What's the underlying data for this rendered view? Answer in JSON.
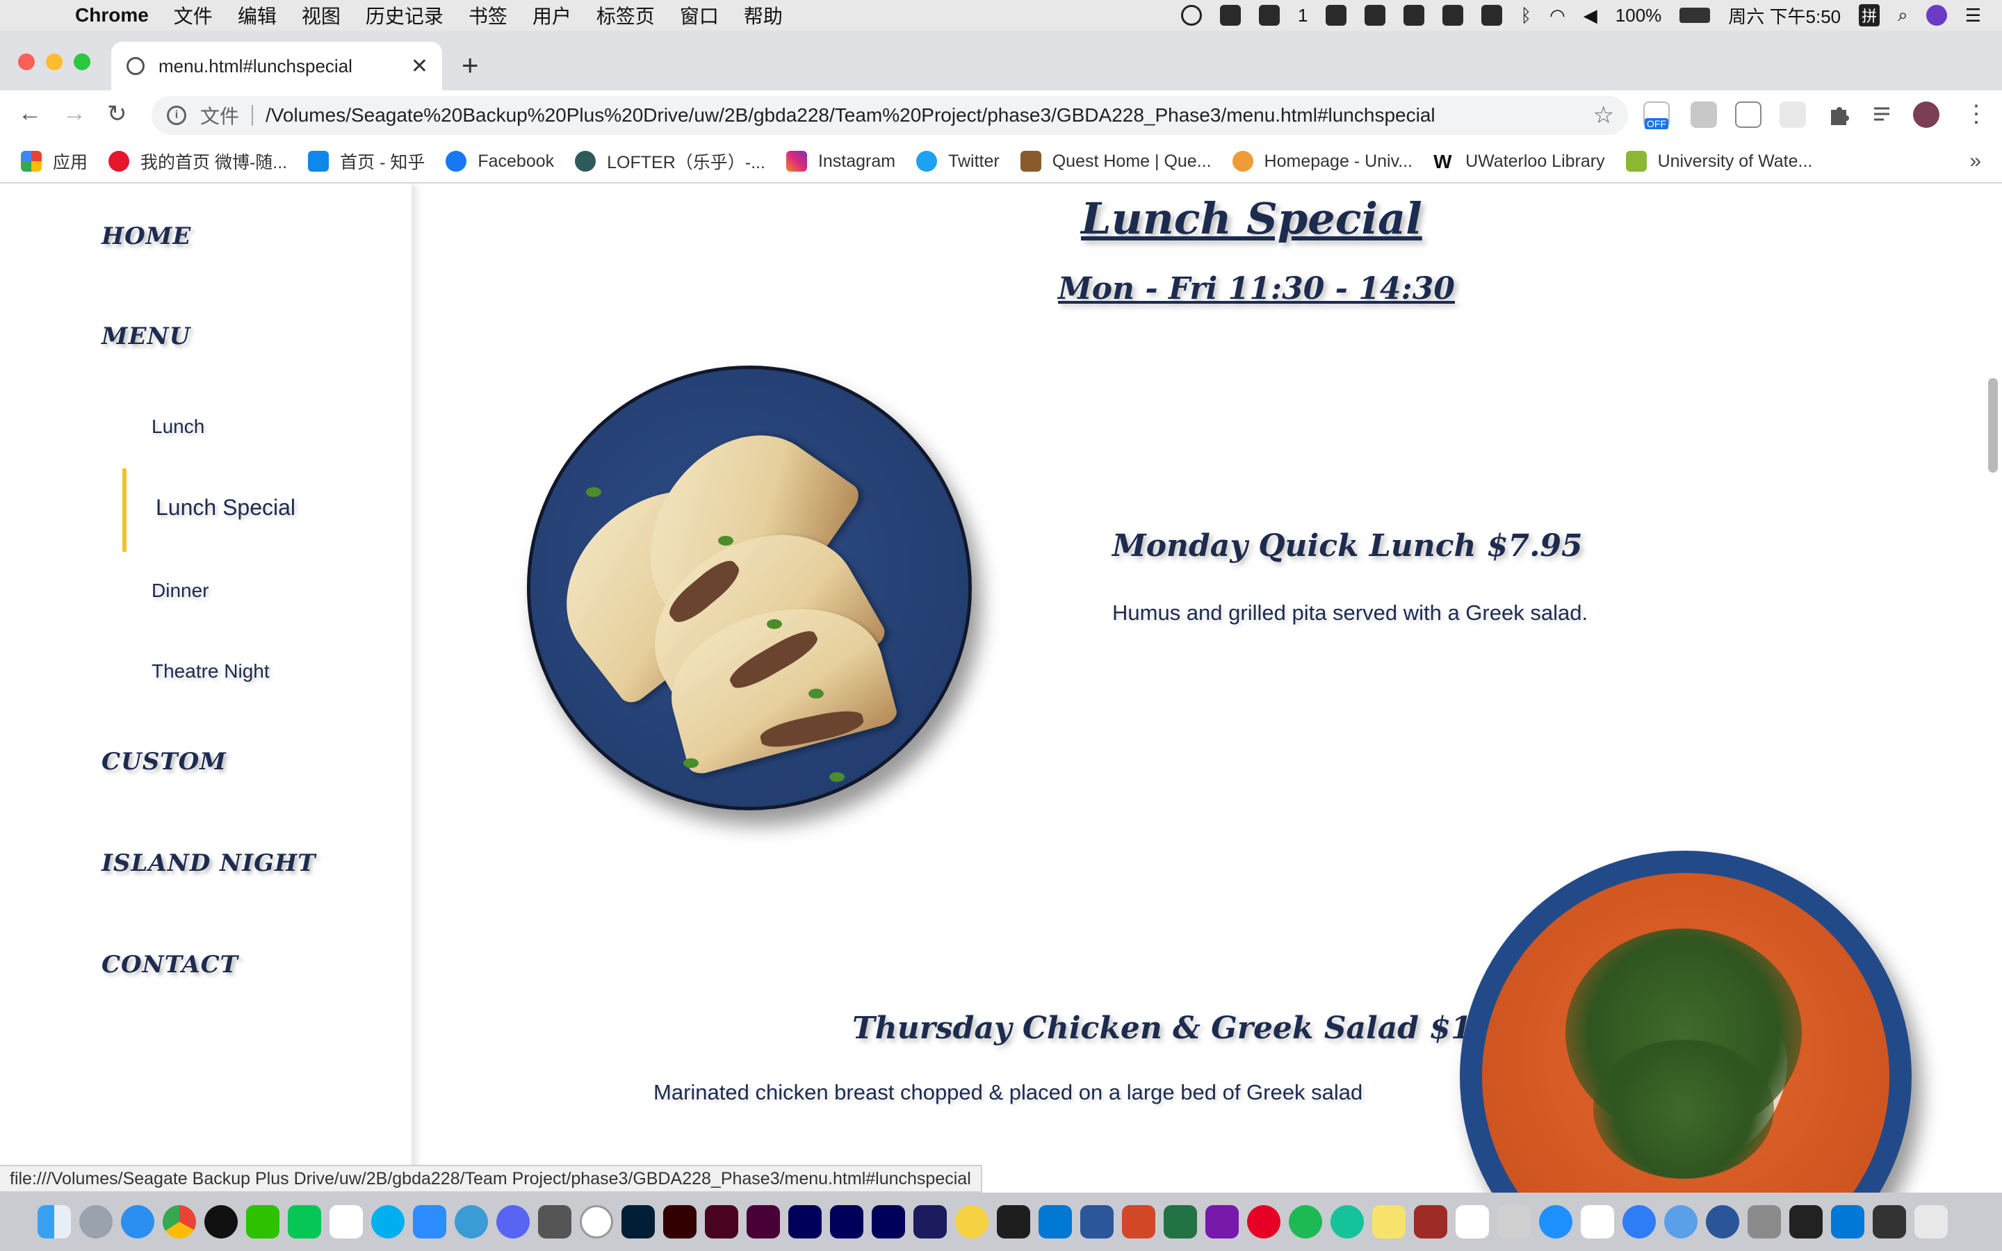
{
  "menubar": {
    "app_name": "Chrome",
    "items": [
      "文件",
      "编辑",
      "视图",
      "历史记录",
      "书签",
      "用户",
      "标签页",
      "窗口",
      "帮助"
    ],
    "wechat_count": "1",
    "battery": "100%",
    "datetime": "周六 下午5:50",
    "input_method": "拼"
  },
  "browser": {
    "tab_title": "menu.html#lunchspecial",
    "new_tab_glyph": "+",
    "address_scheme": "文件",
    "address_url": "/Volumes/Seagate%20Backup%20Plus%20Drive/uw/2B/gbda228/Team%20Project/phase3/GBDA228_Phase3/menu.html#lunchspecial",
    "ext_off_label": "OFF",
    "bookmarks": [
      {
        "label": "应用",
        "icon": "apps-grid-icon",
        "color": "#e94235"
      },
      {
        "label": "我的首页 微博-随...",
        "icon": "weibo-icon",
        "color": "#e6162d"
      },
      {
        "label": "首页 - 知乎",
        "icon": "zhihu-icon",
        "color": "#0f88eb"
      },
      {
        "label": "Facebook",
        "icon": "facebook-icon",
        "color": "#1877f2"
      },
      {
        "label": "LOFTER（乐乎）-...",
        "icon": "lofter-icon",
        "color": "#2f5a5a"
      },
      {
        "label": "Instagram",
        "icon": "instagram-icon",
        "color": "#c13584"
      },
      {
        "label": "Twitter",
        "icon": "twitter-icon",
        "color": "#1da1f2"
      },
      {
        "label": "Quest Home | Que...",
        "icon": "quest-icon",
        "color": "#8a5a2b"
      },
      {
        "label": "Homepage - Univ...",
        "icon": "homepage-icon",
        "color": "#f19a38"
      },
      {
        "label": "UWaterloo Library",
        "icon": "uwaterloo-library-icon",
        "color": "#111111"
      },
      {
        "label": "University of Wate...",
        "icon": "university-icon",
        "color": "#8ab833"
      }
    ],
    "bookmarks_more": "»",
    "status_url": "file:///Volumes/Seagate Backup Plus Drive/uw/2B/gbda228/Team Project/phase3/GBDA228_Phase3/menu.html#lunchspecial"
  },
  "sidebar": {
    "home": "HOME",
    "menu": "MENU",
    "sub_lunch": "Lunch",
    "sub_lunch_special": "Lunch Special",
    "sub_dinner": "Dinner",
    "sub_theatre": "Theatre Night",
    "custom": "CUSTOM",
    "island": "ISLAND NIGHT",
    "contact": "CONTACT",
    "active_color": "#f2c12e"
  },
  "content": {
    "title": "Lunch Special",
    "subtitle": "Mon - Fri 11:30 - 14:30",
    "dishes": [
      {
        "name": "Monday Quick Lunch $7.95",
        "desc": "Humus and grilled pita served with a Greek salad."
      },
      {
        "name": "Thursday Chicken & Greek Salad $10.95",
        "desc": "Marinated chicken breast chopped & placed on a large bed of Greek salad"
      }
    ]
  },
  "theme": {
    "navy": "#1d2b4f",
    "accent": "#f2c12e"
  }
}
